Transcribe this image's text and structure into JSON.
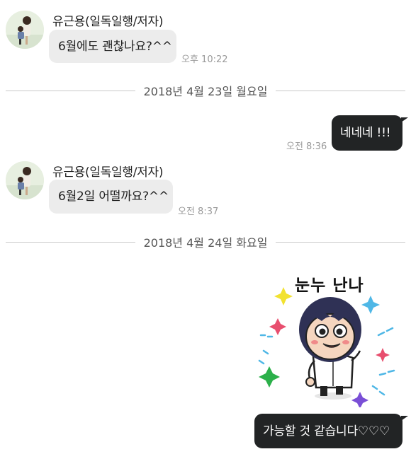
{
  "messages": {
    "m1": {
      "sender": "유근용(일독일행/저자)",
      "text": "6월에도 괜찮나요?^^",
      "time": "오후 10:22"
    },
    "date1": "2018년 4월 23일 월요일",
    "m2": {
      "text": "네네네 !!!",
      "time": "오전 8:36"
    },
    "m3": {
      "sender": "유근용(일독일행/저자)",
      "text": "6월2일 어떨까요?^^",
      "time": "오전 8:37"
    },
    "date2": "2018년 4월 24일 화요일",
    "sticker": {
      "caption": "눈누 난나",
      "icon": "dancing-character-sticker"
    },
    "m4": {
      "text": "가능할 것 같습니다♡♡♡"
    }
  },
  "colors": {
    "incoming_bubble": "#ececec",
    "outgoing_bubble": "#222425",
    "timestamp": "#9a9a9a"
  }
}
